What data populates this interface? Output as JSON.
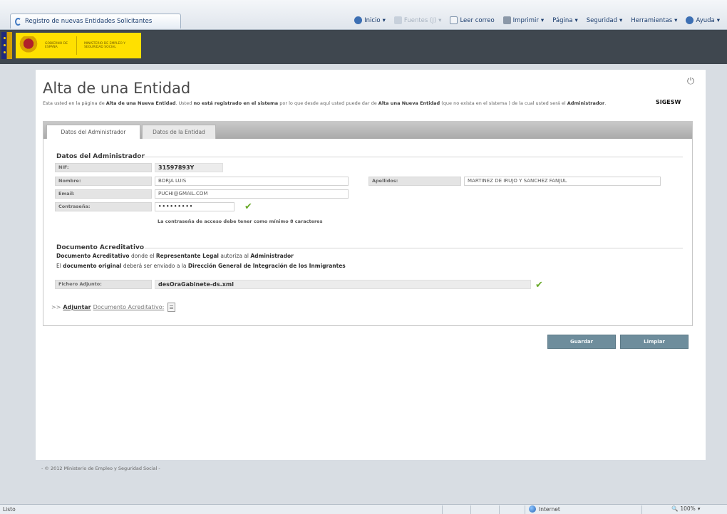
{
  "browser": {
    "tab_title": "Registro de nuevas Entidades Solicitantes",
    "toolbar": {
      "inicio": "Inicio",
      "fuentes": "Fuentes (J)",
      "leer_correo": "Leer correo",
      "imprimir": "Imprimir",
      "pagina": "Página",
      "seguridad": "Seguridad",
      "herramientas": "Herramientas",
      "ayuda": "Ayuda"
    }
  },
  "header": {
    "gov_line1": "GOBIERNO DE ESPAÑA",
    "gov_line2": "MINISTERIO DE EMPLEO Y SEGURIDAD SOCIAL"
  },
  "page": {
    "title": "Alta de una Entidad",
    "intro_1": "Esta usted en la página de ",
    "intro_b1": "Alta de una Nueva Entidad",
    "intro_2": ". Usted ",
    "intro_b2": "no está registrado en el sistema",
    "intro_3": " por lo que desde aquí usted puede dar de ",
    "intro_b3": "Alta una Nueva Entidad",
    "intro_4": " (que no exista en el sistema ",
    "intro_5": ") de la cual usted será el ",
    "intro_b4": "Administrador",
    "intro_6": ".",
    "system_name": "SIGESW"
  },
  "tabs": {
    "admin": "Datos del Administrador",
    "entidad": "Datos de la Entidad"
  },
  "admin_section": {
    "title": "Datos del Administrador",
    "nif_label": "NIF:",
    "nif_value": "31597893Y",
    "nombre_label": "Nombre:",
    "nombre_value": "BORJA LUIS",
    "apellidos_label": "Apellidos:",
    "apellidos_value": "MARTINEZ DE IRUJO Y SANCHEZ FANJUL",
    "email_label": "Email:",
    "email_value": "PUCHI@GMAIL.COM",
    "password_label": "Contraseña:",
    "password_value": "•••••••••",
    "password_note": "La contraseña de acceso debe tener como mínimo 8 caracteres"
  },
  "doc_section": {
    "title": "Documento Acreditativo",
    "line1_b1": "Documento Acreditativo",
    "line1_t1": " donde el ",
    "line1_b2": "Representante Legal",
    "line1_t2": " autoriza al ",
    "line1_b3": "Administrador",
    "line2_t1": "El ",
    "line2_b1": "documento original",
    "line2_t2": " deberá ser enviado a la ",
    "line2_b2": "Dirección General de Integración de los Inmigrantes",
    "file_label": "Fichero Adjunto:",
    "file_value": "desOraGabinete-ds.xml",
    "attach_arrow": ">>",
    "attach_strong": "Adjuntar",
    "attach_soft": "Documento Acreditativo:"
  },
  "buttons": {
    "guardar": "Guardar",
    "limpiar": "Limpiar"
  },
  "footer": {
    "text": "- © 2012 Ministerio de Empleo y Seguridad Social -"
  },
  "status": {
    "left": "Listo",
    "zone": "Internet",
    "zoom": "100%"
  }
}
